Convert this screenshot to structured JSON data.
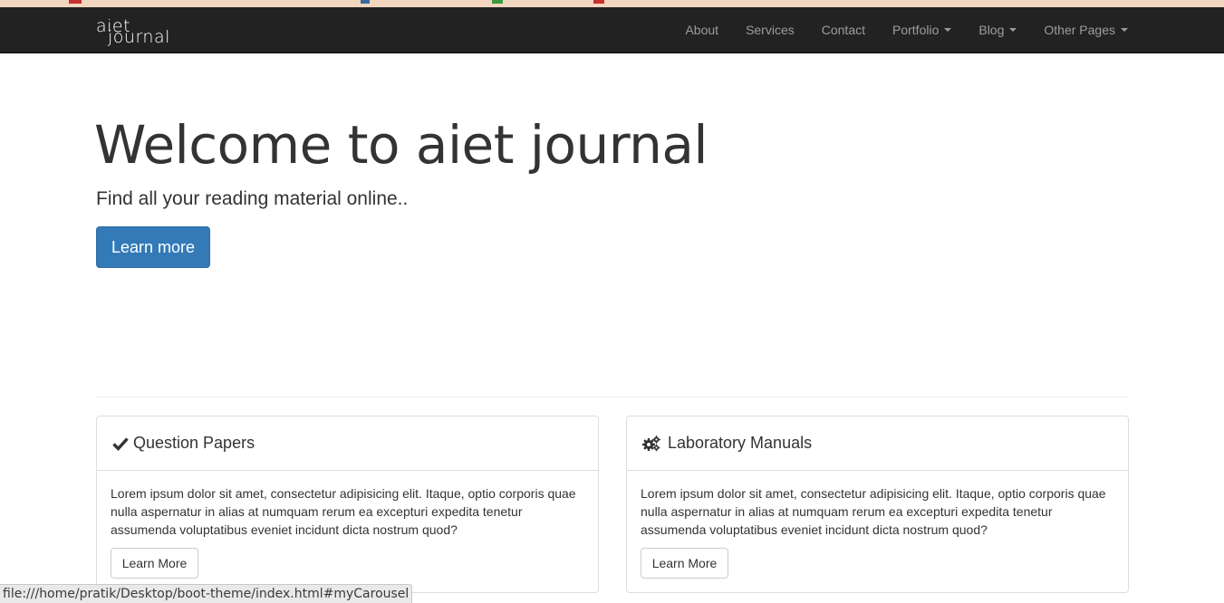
{
  "brand": {
    "line1": "aiet",
    "line2": "journal"
  },
  "nav": {
    "items": [
      {
        "label": "About",
        "dropdown": false
      },
      {
        "label": "Services",
        "dropdown": false
      },
      {
        "label": "Contact",
        "dropdown": false
      },
      {
        "label": "Portfolio",
        "dropdown": true
      },
      {
        "label": "Blog",
        "dropdown": true
      },
      {
        "label": "Other Pages",
        "dropdown": true
      }
    ]
  },
  "hero": {
    "title": "Welcome to aiet journal",
    "subtitle": "Find all your reading material online..",
    "button_label": "Learn more"
  },
  "panels": [
    {
      "icon": "check-icon",
      "title": "Question Papers",
      "body": "Lorem ipsum dolor sit amet, consectetur adipisicing elit. Itaque, optio corporis quae nulla aspernatur in alias at numquam rerum ea excepturi expedita tenetur assumenda voluptatibus eveniet incidunt dicta nostrum quod?",
      "button_label": "Learn More"
    },
    {
      "icon": "gears-icon",
      "title": "Laboratory Manuals",
      "body": "Lorem ipsum dolor sit amet, consectetur adipisicing elit. Itaque, optio corporis quae nulla aspernatur in alias at numquam rerum ea excepturi expedita tenetur assumenda voluptatibus eveniet incidunt dicta nostrum quod?",
      "button_label": "Learn More"
    }
  ],
  "status_bar": {
    "url": "file:///home/pratik/Desktop/boot-theme/index.html#myCarousel"
  },
  "colors": {
    "navbar": "#222222",
    "nav_text": "#9d9d9d",
    "primary": "#337ab7",
    "text": "#333333"
  }
}
